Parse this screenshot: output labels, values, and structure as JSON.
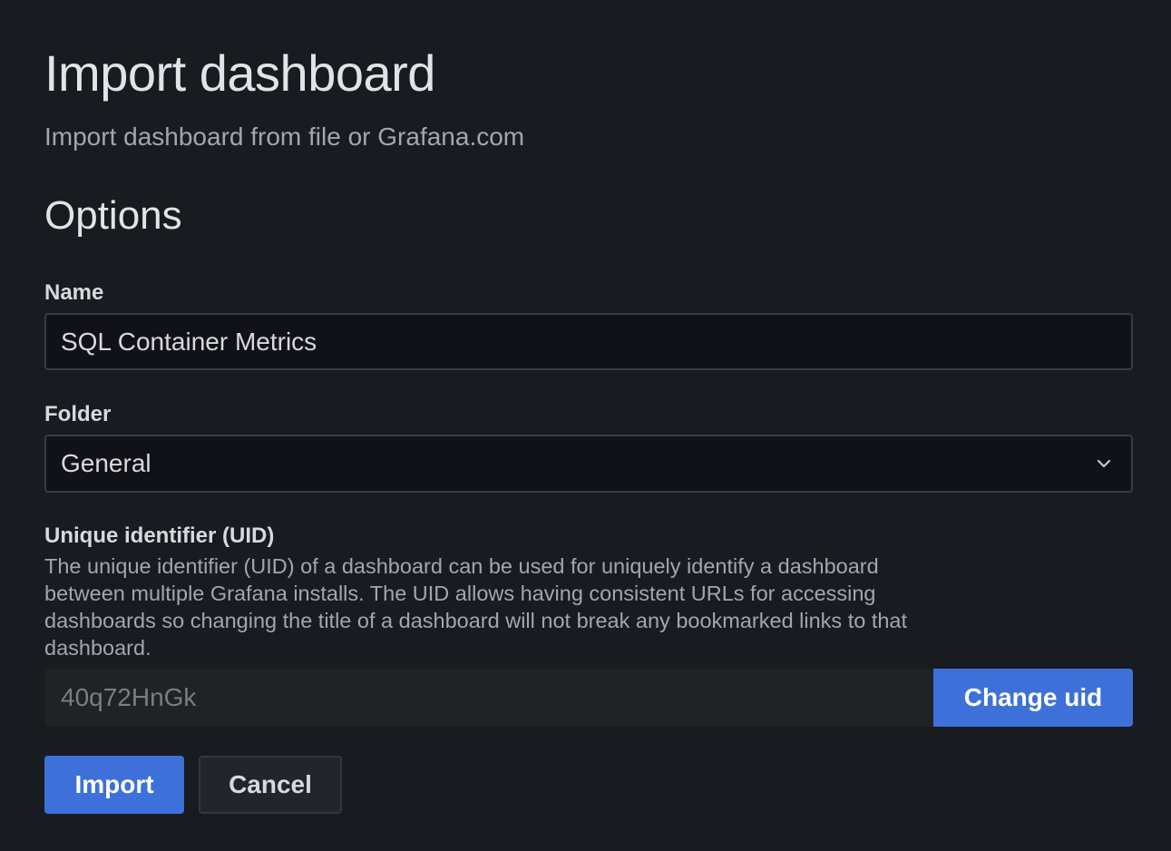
{
  "header": {
    "title": "Import dashboard",
    "subtitle": "Import dashboard from file or Grafana.com"
  },
  "options": {
    "section_title": "Options",
    "name": {
      "label": "Name",
      "value": "SQL Container Metrics"
    },
    "folder": {
      "label": "Folder",
      "selected": "General",
      "icon": "chevron-down-icon"
    },
    "uid": {
      "label": "Unique identifier (UID)",
      "description": "The unique identifier (UID) of a dashboard can be used for uniquely identify a dashboard between multiple Grafana installs. The UID allows having consistent URLs for accessing dashboards so changing the title of a dashboard will not break any bookmarked links to that dashboard.",
      "value": "40q72HnGk",
      "change_label": "Change uid"
    }
  },
  "actions": {
    "import_label": "Import",
    "cancel_label": "Cancel"
  },
  "colors": {
    "background": "#181b1f",
    "primary": "#3d71d9",
    "input_bg": "#111217"
  }
}
